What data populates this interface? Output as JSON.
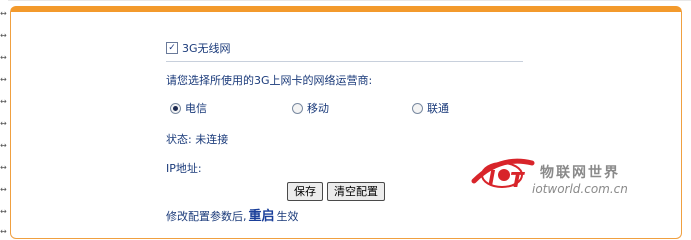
{
  "form": {
    "enable_3g": {
      "label": "3G无线网",
      "checked": true
    },
    "question": "请您选择所使用的3G上网卡的网络运营商:",
    "carriers": [
      {
        "label": "电信",
        "selected": true
      },
      {
        "label": "移动",
        "selected": false
      },
      {
        "label": "联通",
        "selected": false
      }
    ],
    "status_text": "状态: 未连接",
    "ip_label": "IP地址:",
    "save_label": "保存",
    "clear_label": "清空配置",
    "note_prefix": "修改配置参数后,",
    "note_emphasis": "重启",
    "note_suffix": "生效"
  },
  "watermark": {
    "name_cn": "物联网世界",
    "domain": "iotworld.com.cn",
    "logo_icon": "iot-logo-icon"
  },
  "colors": {
    "panel_border": "#f39a2c",
    "text": "#1a3a7a",
    "logo_red": "#d8242a"
  }
}
